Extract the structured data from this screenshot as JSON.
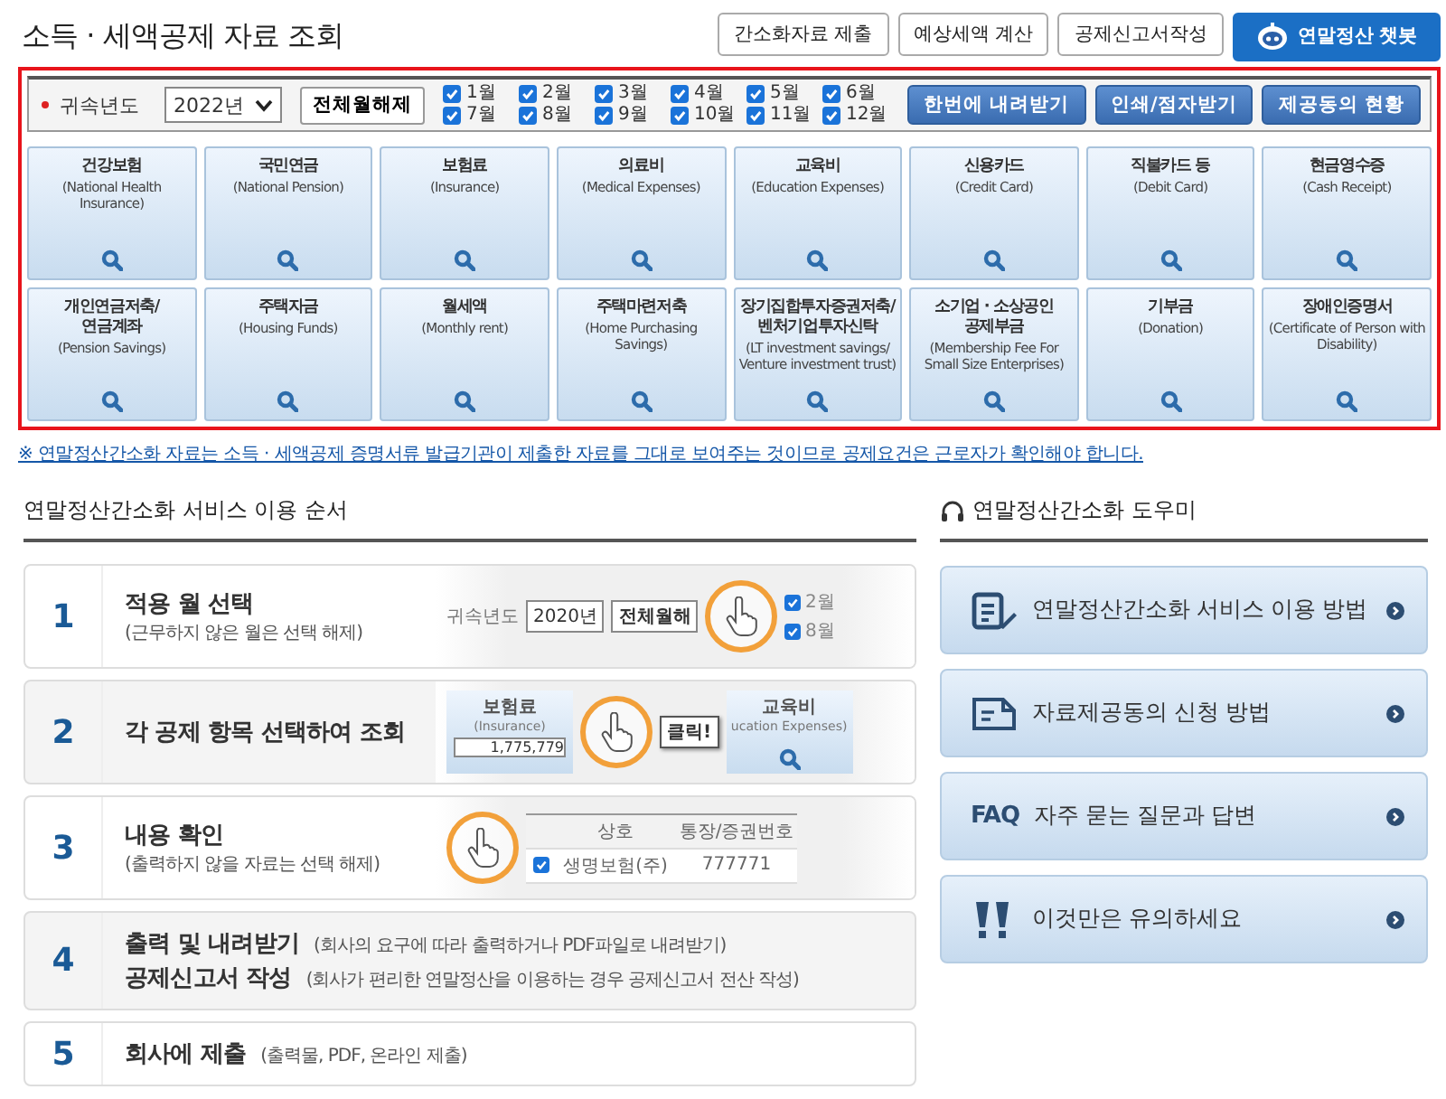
{
  "page_title": "소득 · 세액공제 자료 조회",
  "top_buttons": [
    {
      "label": "간소화자료 제출",
      "kind": "plain"
    },
    {
      "label": "예상세액 계산",
      "kind": "plain"
    },
    {
      "label": "공제신고서작성",
      "kind": "plain"
    },
    {
      "label": "연말정산 챗봇",
      "kind": "chatbot"
    }
  ],
  "filter": {
    "year_label": "귀속년도",
    "year_value": "2022년",
    "toggle_button": "전체월해제",
    "months": [
      {
        "label": "1월",
        "checked": true
      },
      {
        "label": "2월",
        "checked": true
      },
      {
        "label": "3월",
        "checked": true
      },
      {
        "label": "4월",
        "checked": true
      },
      {
        "label": "5월",
        "checked": true
      },
      {
        "label": "6월",
        "checked": true
      },
      {
        "label": "7월",
        "checked": true
      },
      {
        "label": "8월",
        "checked": true
      },
      {
        "label": "9월",
        "checked": true
      },
      {
        "label": "10월",
        "checked": true
      },
      {
        "label": "11월",
        "checked": true
      },
      {
        "label": "12월",
        "checked": true
      }
    ],
    "actions": [
      "한번에 내려받기",
      "인쇄/점자받기",
      "제공동의 현황"
    ]
  },
  "categories": [
    {
      "name": "건강보험",
      "english": "(National Health Insurance)"
    },
    {
      "name": "국민연금",
      "english": "(National Pension)"
    },
    {
      "name": "보험료",
      "english": "(Insurance)"
    },
    {
      "name": "의료비",
      "english": "(Medical Expenses)"
    },
    {
      "name": "교육비",
      "english": "(Education Expenses)"
    },
    {
      "name": "신용카드",
      "english": "(Credit Card)"
    },
    {
      "name": "직불카드 등",
      "english": "(Debit Card)"
    },
    {
      "name": "현금영수증",
      "english": "(Cash Receipt)"
    },
    {
      "name": "개인연금저축/\n연금계좌",
      "english": "(Pension Savings)"
    },
    {
      "name": "주택자금",
      "english": "(Housing Funds)"
    },
    {
      "name": "월세액",
      "english": "(Monthly rent)"
    },
    {
      "name": "주택마련저축",
      "english": "(Home Purchasing Savings)"
    },
    {
      "name": "장기집합투자증권저축/\n벤처기업투자신탁",
      "english": "(LT investment savings/ Venture investment trust)"
    },
    {
      "name": "소기업 · 소상공인\n공제부금",
      "english": "(Membership Fee For Small Size Enterprises)"
    },
    {
      "name": "기부금",
      "english": "(Donation)"
    },
    {
      "name": "장애인증명서",
      "english": "(Certificate of Person with Disability)"
    }
  ],
  "notice": "※ 연말정산간소화 자료는 소득 · 세액공제 증명서류 발급기관이 제출한 자료를 그대로 보여주는 것이므로 공제요건은 근로자가 확인해야 합니다.",
  "steps_section": {
    "title": "연말정산간소화 서비스 이용 순서",
    "steps": [
      {
        "number": "1",
        "kind": "stacked",
        "lines": [
          {
            "title": "적용 월 선택",
            "note": "(근무하지 않은 월은 선택 해제)"
          }
        ],
        "illustration": [
          {
            "kind": "label",
            "text": "귀속년도"
          },
          {
            "kind": "select",
            "text": "2020년"
          },
          {
            "kind": "button",
            "text": "전체월해"
          },
          {
            "kind": "magnifier"
          },
          {
            "kind": "checks",
            "items": [
              {
                "label": "2월",
                "checked": true
              },
              {
                "label": "8월",
                "checked": true
              }
            ]
          }
        ]
      },
      {
        "number": "2",
        "kind": "stacked",
        "lines": [
          {
            "title": "각 공제 항목 선택하여 조회"
          }
        ],
        "illustration": [
          {
            "kind": "tile",
            "title": "보험료",
            "sub": "(Insurance)",
            "value": "1,775,779"
          },
          {
            "kind": "magnifier"
          },
          {
            "kind": "callout",
            "text": "클릭!"
          },
          {
            "kind": "tile",
            "title": "교육비",
            "sub": "ucation Expenses)"
          }
        ]
      },
      {
        "number": "3",
        "kind": "stacked",
        "lines": [
          {
            "title": "내용 확인",
            "note": "(출력하지 않을 자료는 선택 해제)"
          }
        ],
        "illustration": [
          {
            "kind": "magnifier"
          },
          {
            "kind": "table",
            "header": [
              "상호",
              "통장/증권번호"
            ],
            "row_checked": true,
            "row": [
              "생명보험(주)",
              "777771"
            ]
          }
        ]
      },
      {
        "number": "4",
        "kind": "inline",
        "lines": [
          {
            "title": "출력 및 내려받기",
            "note": "(회사의 요구에 따라 출력하거나 PDF파일로 내려받기)"
          },
          {
            "title": "공제신고서 작성",
            "note": "(회사가 편리한 연말정산을 이용하는 경우 공제신고서 전산 작성)"
          }
        ]
      },
      {
        "number": "5",
        "kind": "inline",
        "lines": [
          {
            "title": "회사에 제출",
            "note": "(출력물, PDF, 온라인 제출)"
          }
        ]
      }
    ]
  },
  "helper": {
    "title": "연말정산간소화 도우미",
    "items": [
      {
        "label": "연말정산간소화 서비스 이용 방법",
        "kind": "guide"
      },
      {
        "label": "자료제공동의 신청 방법",
        "kind": "application"
      },
      {
        "label": "자주 묻는 질문과 답변",
        "kind": "faq",
        "prefix": "FAQ"
      },
      {
        "label": "이것만은 유의하세요",
        "kind": "caution"
      }
    ]
  }
}
